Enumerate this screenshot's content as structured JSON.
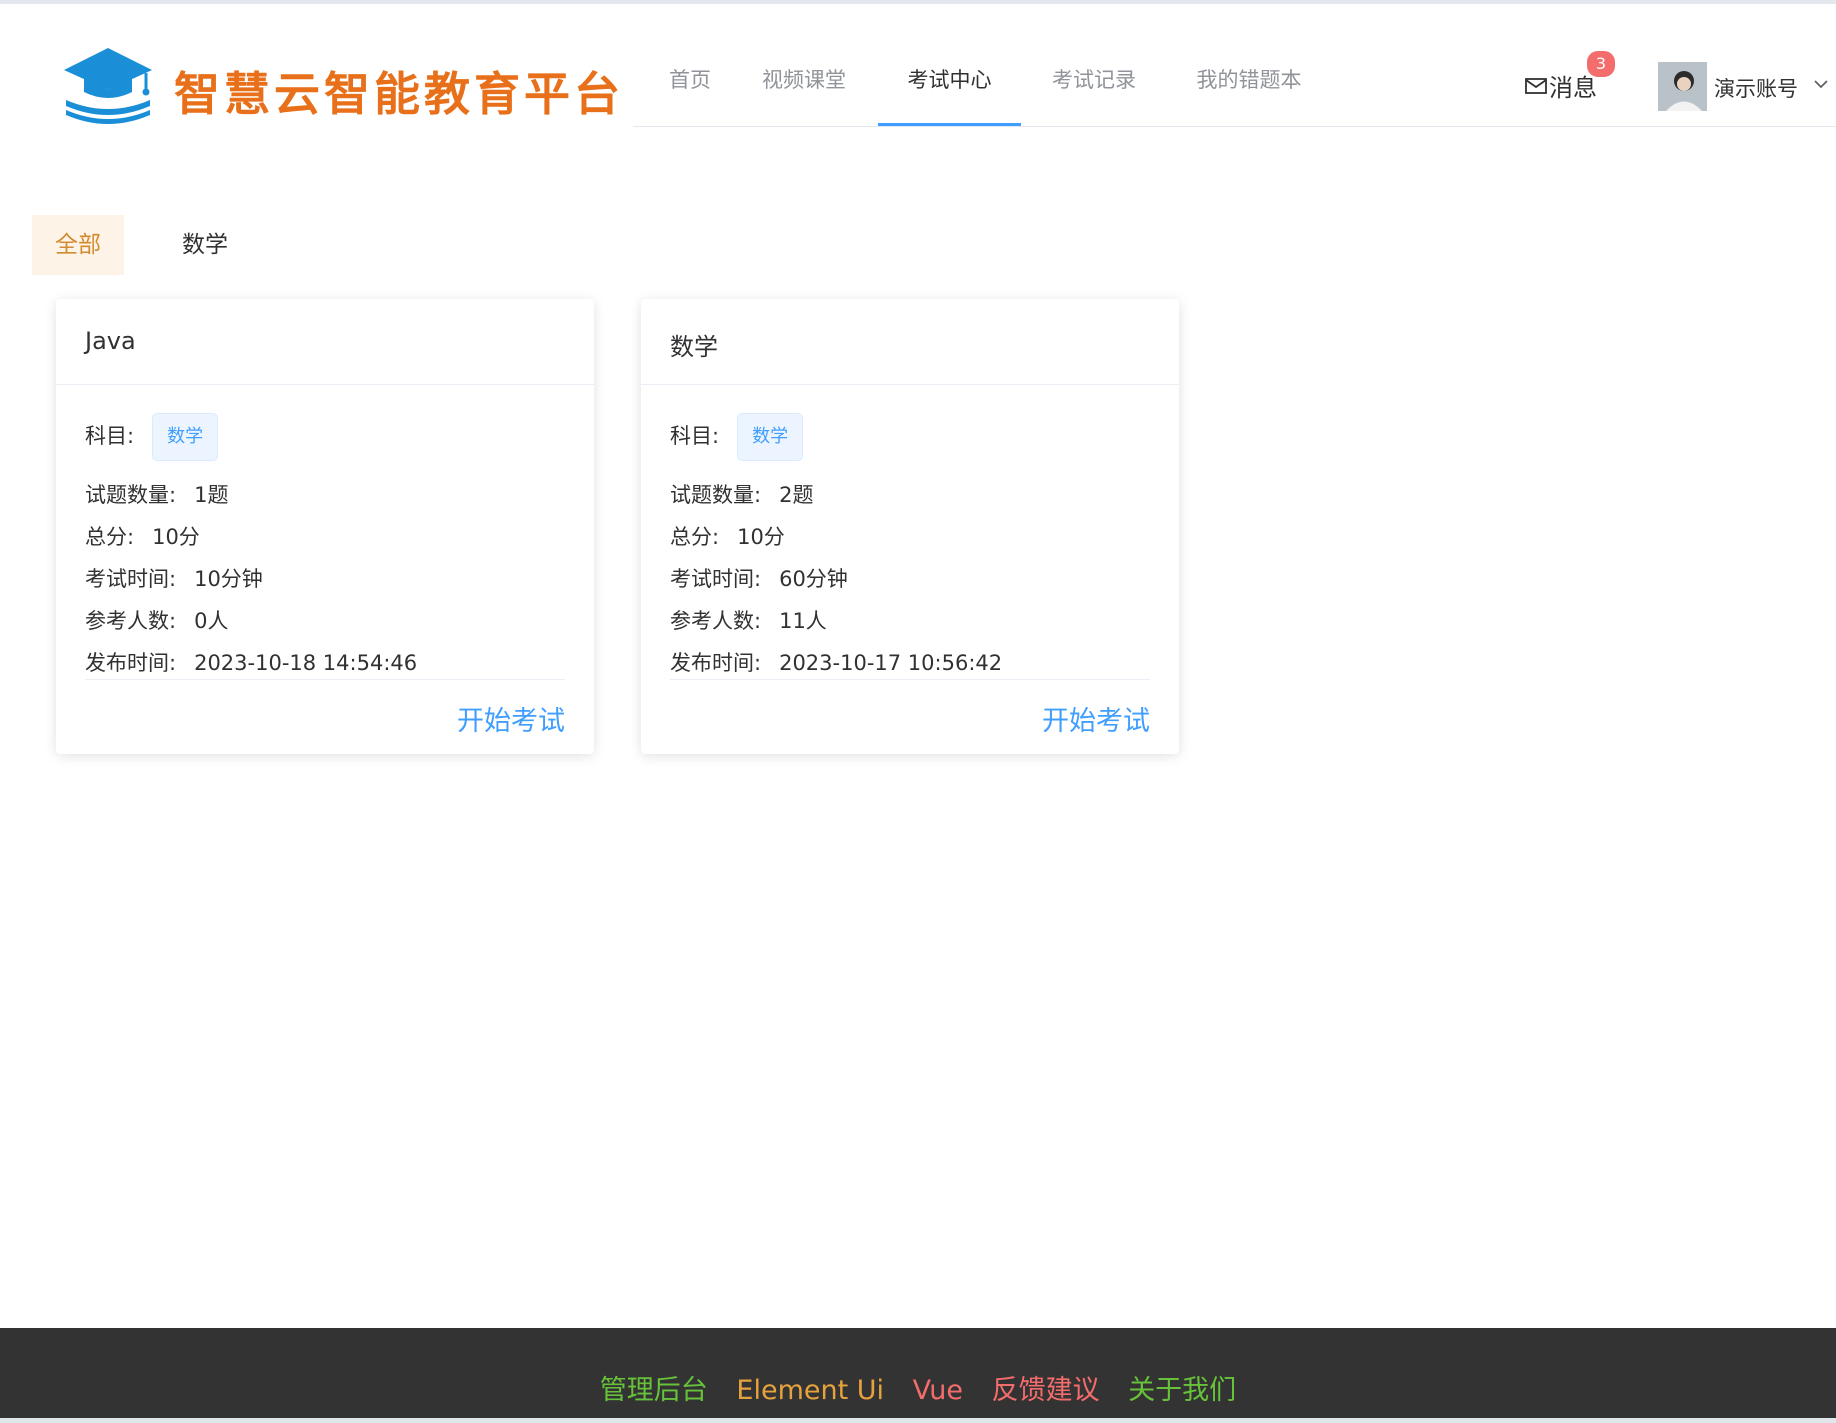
{
  "brand": {
    "name": "智慧云智能教育平台",
    "color": "#e8701a",
    "icon": "graduation-cap-icon"
  },
  "nav": {
    "items": [
      {
        "label": "首页",
        "active": false
      },
      {
        "label": "视频课堂",
        "active": false
      },
      {
        "label": "考试中心",
        "active": true
      },
      {
        "label": "考试记录",
        "active": false
      },
      {
        "label": "我的错题本",
        "active": false
      }
    ],
    "accent": "#409eff"
  },
  "messages": {
    "label": "消息",
    "count": "3",
    "icon": "mail-icon"
  },
  "user": {
    "name": "演示账号",
    "icon": "chevron-down-icon"
  },
  "filters": [
    {
      "label": "全部",
      "active": true
    },
    {
      "label": "数学",
      "active": false
    }
  ],
  "labels": {
    "subject": "科目:",
    "question_count": "试题数量:",
    "total_score": "总分:",
    "duration": "考试时间:",
    "participants": "参考人数:",
    "publish_time": "发布时间:",
    "start": "开始考试"
  },
  "exams": [
    {
      "title": "Java",
      "subject_tag": "数学",
      "question_count": "1题",
      "total_score": "10分",
      "duration": "10分钟",
      "participants": "0人",
      "publish_time": "2023-10-18 14:54:46"
    },
    {
      "title": "数学",
      "subject_tag": "数学",
      "question_count": "2题",
      "total_score": "10分",
      "duration": "60分钟",
      "participants": "11人",
      "publish_time": "2023-10-17 10:56:42"
    }
  ],
  "footer": {
    "links": [
      {
        "label": "管理后台",
        "color": "#67c23a"
      },
      {
        "label": "Element Ui",
        "color": "#e6a23c"
      },
      {
        "label": "Vue",
        "color": "#f56c6c"
      },
      {
        "label": "反馈建议",
        "color": "#f56c6c"
      },
      {
        "label": "关于我们",
        "color": "#67c23a"
      }
    ]
  }
}
